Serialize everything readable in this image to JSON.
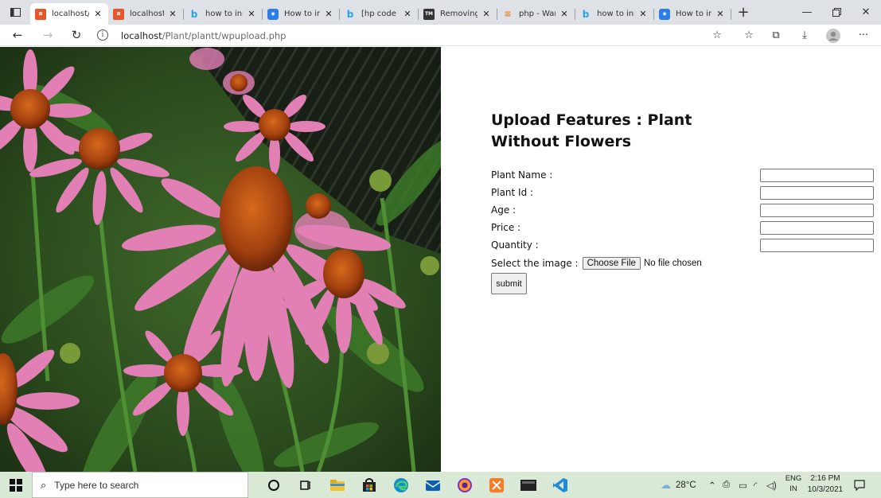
{
  "browser": {
    "tabs": [
      {
        "title": "localhost/P",
        "favicon_color": "#e8542a"
      },
      {
        "title": "localhost/P",
        "favicon_color": "#e8542a"
      },
      {
        "title": "how to ins",
        "favicon_color": "#2ba3e8"
      },
      {
        "title": "How to ins",
        "favicon_color": "#2b7de8"
      },
      {
        "title": "[hp code to",
        "favicon_color": "#2ba3e8"
      },
      {
        "title": "Removing",
        "favicon_color": "#333333"
      },
      {
        "title": "php - Warn",
        "favicon_color": "#f48024"
      },
      {
        "title": "how to ins",
        "favicon_color": "#2ba3e8"
      },
      {
        "title": "How to ins",
        "favicon_color": "#2b7de8"
      }
    ],
    "close_glyph": "✕",
    "new_tab_glyph": "+",
    "url_host": "localhost",
    "url_path": "/Plant/plantt/wpupload.php"
  },
  "form": {
    "heading": "Upload Features : Plant Without Flowers",
    "fields": [
      {
        "label": "Plant Name :",
        "value": ""
      },
      {
        "label": "Plant Id :",
        "value": ""
      },
      {
        "label": "Age :",
        "value": ""
      },
      {
        "label": "Price :",
        "value": ""
      },
      {
        "label": "Quantity :",
        "value": ""
      }
    ],
    "image_label": "Select the image :",
    "choose_file_label": "Choose File",
    "no_file_text": "No file chosen",
    "submit_label": "submit"
  },
  "taskbar": {
    "search_placeholder": "Type here to search",
    "temperature": "28°C",
    "language": "ENG",
    "region": "IN",
    "time": "2:16 PM",
    "date": "10/3/2021"
  }
}
